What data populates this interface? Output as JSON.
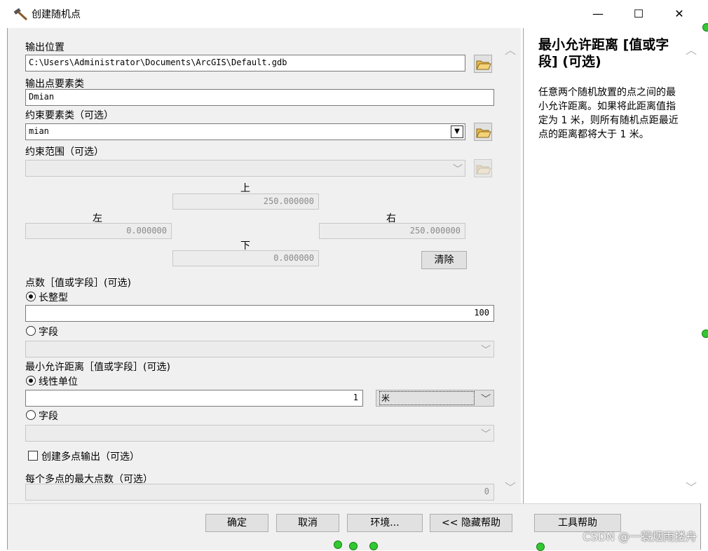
{
  "window": {
    "title": "创建随机点",
    "minimize": "—",
    "maximize": "☐",
    "close": "✕"
  },
  "form": {
    "output_location_label": "输出位置",
    "output_location_value": "C:\\Users\\Administrator\\Documents\\ArcGIS\\Default.gdb",
    "output_fc_label": "输出点要素类",
    "output_fc_value": "Dmian",
    "constraint_fc_label": "约束要素类（可选）",
    "constraint_fc_value": "mian",
    "constraint_extent_label": "约束范围（可选）",
    "extent": {
      "top_label": "上",
      "top_value": "250.000000",
      "left_label": "左",
      "left_value": "0.000000",
      "right_label": "右",
      "right_value": "250.000000",
      "bottom_label": "下",
      "bottom_value": "0.000000",
      "clear_label": "清除"
    },
    "num_points_label": "点数［值或字段］(可选)",
    "num_points_long_label": "长整型",
    "num_points_value": "100",
    "num_points_field_label": "字段",
    "min_dist_label": "最小允许距离［值或字段］(可选)",
    "min_dist_linear_label": "线性单位",
    "min_dist_value": "1",
    "min_dist_unit": "米",
    "min_dist_field_label": "字段",
    "multipoint_label": "创建多点输出（可选）",
    "max_points_label": "每个多点的最大点数（可选）",
    "max_points_value": "0"
  },
  "help": {
    "title": "最小允许距离 [值或字段] (可选)",
    "body": "任意两个随机放置的点之间的最小允许距离。如果将此距离值指定为 1 米，则所有随机点距最近点的距离都将大于 1 米。"
  },
  "buttons": {
    "ok": "确定",
    "cancel": "取消",
    "env": "环境...",
    "hide_help": "<< 隐藏帮助",
    "tool_help": "工具帮助"
  },
  "watermark": "CSDN @一蓑烟雨搂舟"
}
